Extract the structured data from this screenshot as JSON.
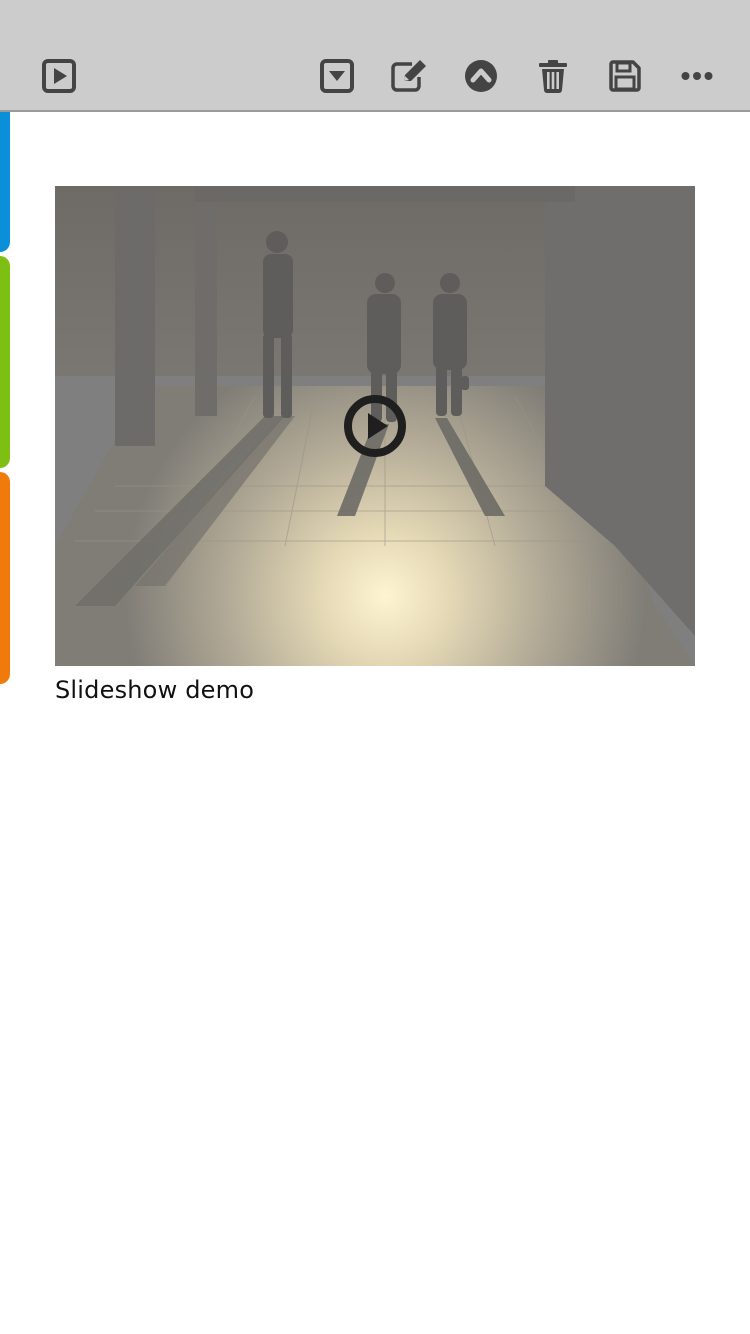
{
  "toolbar": {
    "left_buttons": [
      {
        "name": "present-button",
        "icon": "play-square-icon"
      }
    ],
    "right_buttons": [
      {
        "name": "collapse-button",
        "icon": "caret-down-square-icon"
      },
      {
        "name": "edit-button",
        "icon": "pencil-square-icon"
      },
      {
        "name": "move-up-button",
        "icon": "chevron-up-circle-icon"
      },
      {
        "name": "delete-button",
        "icon": "trash-icon"
      },
      {
        "name": "save-button",
        "icon": "floppy-disk-icon"
      },
      {
        "name": "more-button",
        "icon": "ellipsis-icon"
      }
    ],
    "icon_color": "#444444",
    "background": "#cccccc"
  },
  "side_tabs": [
    {
      "name": "side-tab-blue",
      "color": "#0a8fd8"
    },
    {
      "name": "side-tab-green",
      "color": "#7dbf12"
    },
    {
      "name": "side-tab-orange",
      "color": "#f07a0a"
    }
  ],
  "slideshow": {
    "caption": "Slideshow demo",
    "overlay_icon": "play-circle-icon"
  }
}
